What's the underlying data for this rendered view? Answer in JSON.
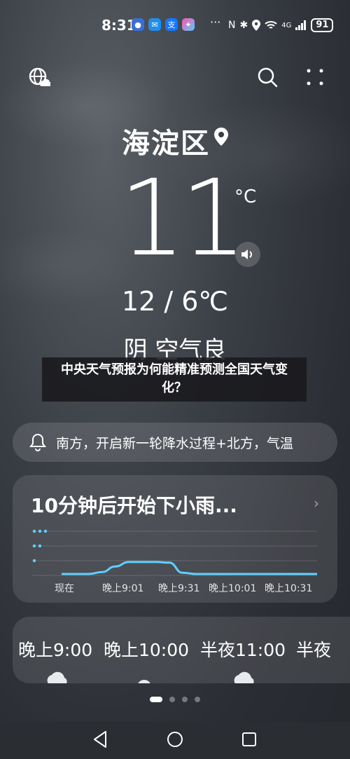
{
  "status": {
    "time": "8:31",
    "more": "···",
    "network": "4G",
    "battery": "91"
  },
  "location": {
    "name": "海淀区"
  },
  "current": {
    "temperature": "11",
    "unit": "°C",
    "range": "12 / 6℃",
    "condition": "阴 空气良"
  },
  "banner": {
    "text": "中央天气预报为何能精准预测全国天气变化？"
  },
  "alert": {
    "text": "南方，开启新一轮降水过程+北方，气温"
  },
  "rain": {
    "title": "10分钟后开始下小雨...",
    "times": [
      "现在",
      "晚上9:01",
      "晚上9:31",
      "晚上10:01",
      "晚上10:31"
    ],
    "intensity_levels": 3,
    "series": [
      0,
      0,
      0,
      0.15,
      0.6,
      0.95,
      0.95,
      0.95,
      0.9,
      0.1,
      0,
      0,
      0,
      0,
      0,
      0,
      0,
      0,
      0,
      0
    ]
  },
  "hourly": {
    "labels": [
      "晚上9:00",
      "晚上10:00",
      "半夜11:00",
      "半夜"
    ]
  },
  "icons": {
    "world": "globe-cloud-icon",
    "search": "search-icon",
    "menu": "more-vertical-icon",
    "pin": "location-pin-icon",
    "sound": "speaker-icon",
    "alert": "bell-icon",
    "chevron": "chevron-right-icon"
  },
  "colors": {
    "rain_line": "#5ed0ff",
    "banner_bg": "#19191c"
  }
}
